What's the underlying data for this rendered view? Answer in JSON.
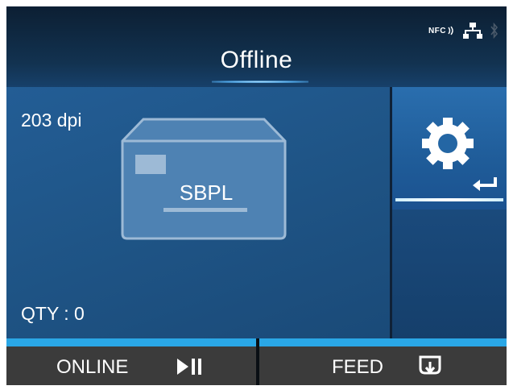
{
  "header": {
    "title": "Offline",
    "status_icons": [
      "nfc-icon",
      "network-icon",
      "bluetooth-icon"
    ],
    "nfc_label": "NFC"
  },
  "main": {
    "resolution": "203 dpi",
    "language_label": "SBPL",
    "quantity": "QTY : 0"
  },
  "settings": {
    "icon": "gear-icon",
    "enter_icon": "enter-arrow-icon"
  },
  "softkeys": {
    "left_label": "ONLINE",
    "left_icon": "play-pause-icon",
    "right_label": "FEED",
    "right_icon": "feed-icon"
  },
  "colors": {
    "accent": "#2aa7e6",
    "panel": "#1f5587",
    "header": "#0f2137",
    "softkey": "#3b3b3b"
  }
}
